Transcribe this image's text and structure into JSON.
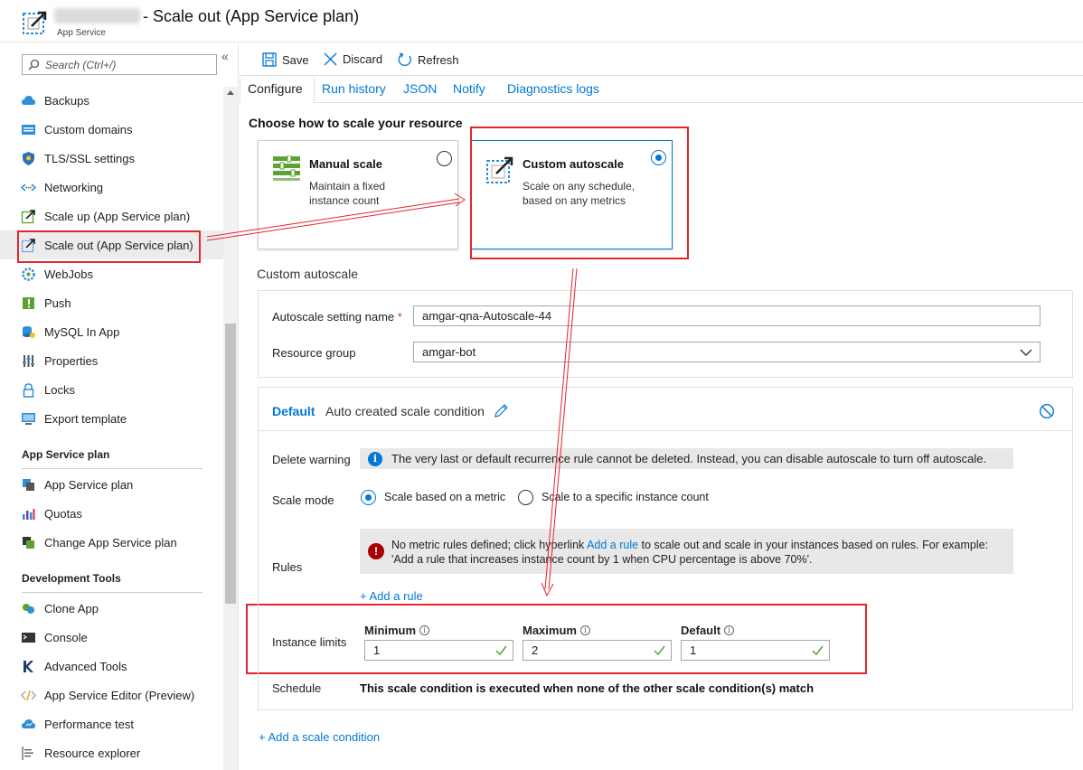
{
  "header": {
    "title": "- Scale out (App Service plan)",
    "subtitle": "App Service"
  },
  "sidebar": {
    "search_placeholder": "Search (Ctrl+/)",
    "collapse": "«",
    "items": [
      {
        "label": "Backups",
        "icon": "cloud-backup-icon"
      },
      {
        "label": "Custom domains",
        "icon": "globe-card-icon"
      },
      {
        "label": "TLS/SSL settings",
        "icon": "shield-icon"
      },
      {
        "label": "Networking",
        "icon": "network-icon"
      },
      {
        "label": "Scale up (App Service plan)",
        "icon": "scale-up-icon"
      },
      {
        "label": "Scale out (App Service plan)",
        "icon": "scale-out-icon"
      },
      {
        "label": "WebJobs",
        "icon": "gear-cog-icon"
      },
      {
        "label": "Push",
        "icon": "push-icon"
      },
      {
        "label": "MySQL In App",
        "icon": "database-icon"
      },
      {
        "label": "Properties",
        "icon": "sliders-icon"
      },
      {
        "label": "Locks",
        "icon": "lock-icon"
      },
      {
        "label": "Export template",
        "icon": "monitor-icon"
      }
    ],
    "section_app_service_plan": "App Service plan",
    "plan_items": [
      {
        "label": "App Service plan",
        "icon": "plan-icon"
      },
      {
        "label": "Quotas",
        "icon": "bar-chart-icon"
      },
      {
        "label": "Change App Service plan",
        "icon": "change-plan-icon"
      }
    ],
    "section_dev_tools": "Development Tools",
    "dev_items": [
      {
        "label": "Clone App",
        "icon": "clone-icon"
      },
      {
        "label": "Console",
        "icon": "console-icon"
      },
      {
        "label": "Advanced Tools",
        "icon": "kudu-icon"
      },
      {
        "label": "App Service Editor (Preview)",
        "icon": "code-icon"
      },
      {
        "label": "Performance test",
        "icon": "cloud-test-icon"
      },
      {
        "label": "Resource explorer",
        "icon": "explorer-icon"
      }
    ]
  },
  "toolbar": {
    "save": "Save",
    "discard": "Discard",
    "refresh": "Refresh"
  },
  "tabs": [
    "Configure",
    "Run history",
    "JSON",
    "Notify",
    "Diagnostics logs"
  ],
  "choose_heading": "Choose how to scale your resource",
  "manual_card": {
    "title": "Manual scale",
    "desc": "Maintain a fixed instance count"
  },
  "custom_card": {
    "title": "Custom autoscale",
    "desc": "Scale on any schedule, based on any metrics"
  },
  "custom_autoscale_heading": "Custom autoscale",
  "form": {
    "setting_name_label": "Autoscale setting name",
    "required_mark": "*",
    "setting_name_value": "amgar-qna-Autoscale-44",
    "resource_group_label": "Resource group",
    "resource_group_value": "amgar-bot"
  },
  "condition": {
    "name": "Default",
    "desc": "Auto created scale condition",
    "delete_warning_label": "Delete warning",
    "delete_warning_text": "The very last or default recurrence rule cannot be deleted. Instead, you can disable autoscale to turn off autoscale.",
    "scale_mode_label": "Scale mode",
    "scale_mode_metric": "Scale based on a metric",
    "scale_mode_count": "Scale to a specific instance count",
    "rules_label": "Rules",
    "rules_msg_before": "No metric rules defined; click hyperlink ",
    "rules_msg_link": "Add a rule",
    "rules_msg_after": " to scale out and scale in your instances based on rules. For example: 'Add a rule that increases instance count by 1 when CPU percentage is above 70%'.",
    "add_rule": "+ Add a rule",
    "instance_limits_label": "Instance limits",
    "minimum_label": "Minimum",
    "minimum_value": "1",
    "maximum_label": "Maximum",
    "maximum_value": "2",
    "default_label": "Default",
    "default_value": "1",
    "schedule_label": "Schedule",
    "schedule_text": "This scale condition is executed when none of the other scale condition(s) match"
  },
  "add_scale_condition": "+ Add a scale condition",
  "colors": {
    "accent": "#0078d4",
    "highlight_red": "#e3262c",
    "error": "#a80000",
    "check": "#5ba233"
  }
}
